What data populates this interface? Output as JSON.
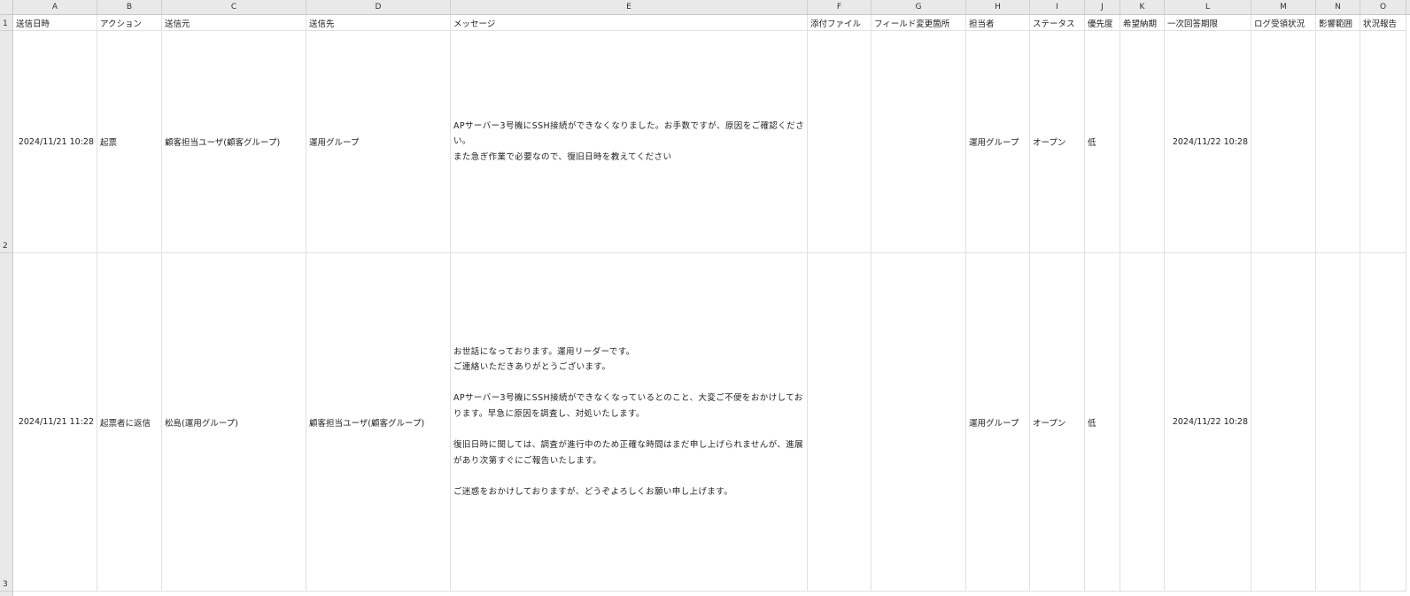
{
  "columns": [
    "A",
    "B",
    "C",
    "D",
    "E",
    "F",
    "G",
    "H",
    "I",
    "J",
    "K",
    "L",
    "M",
    "N",
    "O"
  ],
  "row_numbers": [
    "1",
    "2",
    "3"
  ],
  "headers": {
    "A": "送信日時",
    "B": "アクション",
    "C": "送信元",
    "D": "送信先",
    "E": "メッセージ",
    "F": "添付ファイル",
    "G": "フィールド変更箇所",
    "H": "担当者",
    "I": "ステータス",
    "J": "優先度",
    "K": "希望納期",
    "L": "一次回答期限",
    "M": "ログ受領状況",
    "N": "影響範囲",
    "O": "状況報告"
  },
  "rows": [
    {
      "A": "2024/11/21 10:28",
      "B": "起票",
      "C": "顧客担当ユーザ(顧客グループ)",
      "D": "運用グループ",
      "E": "APサーバー3号機にSSH接続ができなくなりました。お手数ですが、原因をご確認ください。\nまた急ぎ作業で必要なので、復旧日時を教えてください",
      "F": "",
      "G": "",
      "H": "運用グループ",
      "I": "オープン",
      "J": "低",
      "K": "",
      "L": "2024/11/22 10:28",
      "M": "",
      "N": "",
      "O": ""
    },
    {
      "A": "2024/11/21 11:22",
      "B": "起票者に返信",
      "C": "松島(運用グループ)",
      "D": "顧客担当ユーザ(顧客グループ)",
      "E": "お世話になっております。運用リーダーです。\nご連絡いただきありがとうございます。\n\nAPサーバー3号機にSSH接続ができなくなっているとのこと、大変ご不便をおかけしております。早急に原因を調査し、対処いたします。\n\n復旧日時に関しては、調査が進行中のため正確な時間はまだ申し上げられませんが、進展があり次第すぐにご報告いたします。\n\nご迷惑をおかけしておりますが、どうぞよろしくお願い申し上げます。",
      "F": "",
      "G": "",
      "H": "運用グループ",
      "I": "オープン",
      "J": "低",
      "K": "",
      "L": "2024/11/22 10:28",
      "M": "",
      "N": "",
      "O": ""
    }
  ]
}
